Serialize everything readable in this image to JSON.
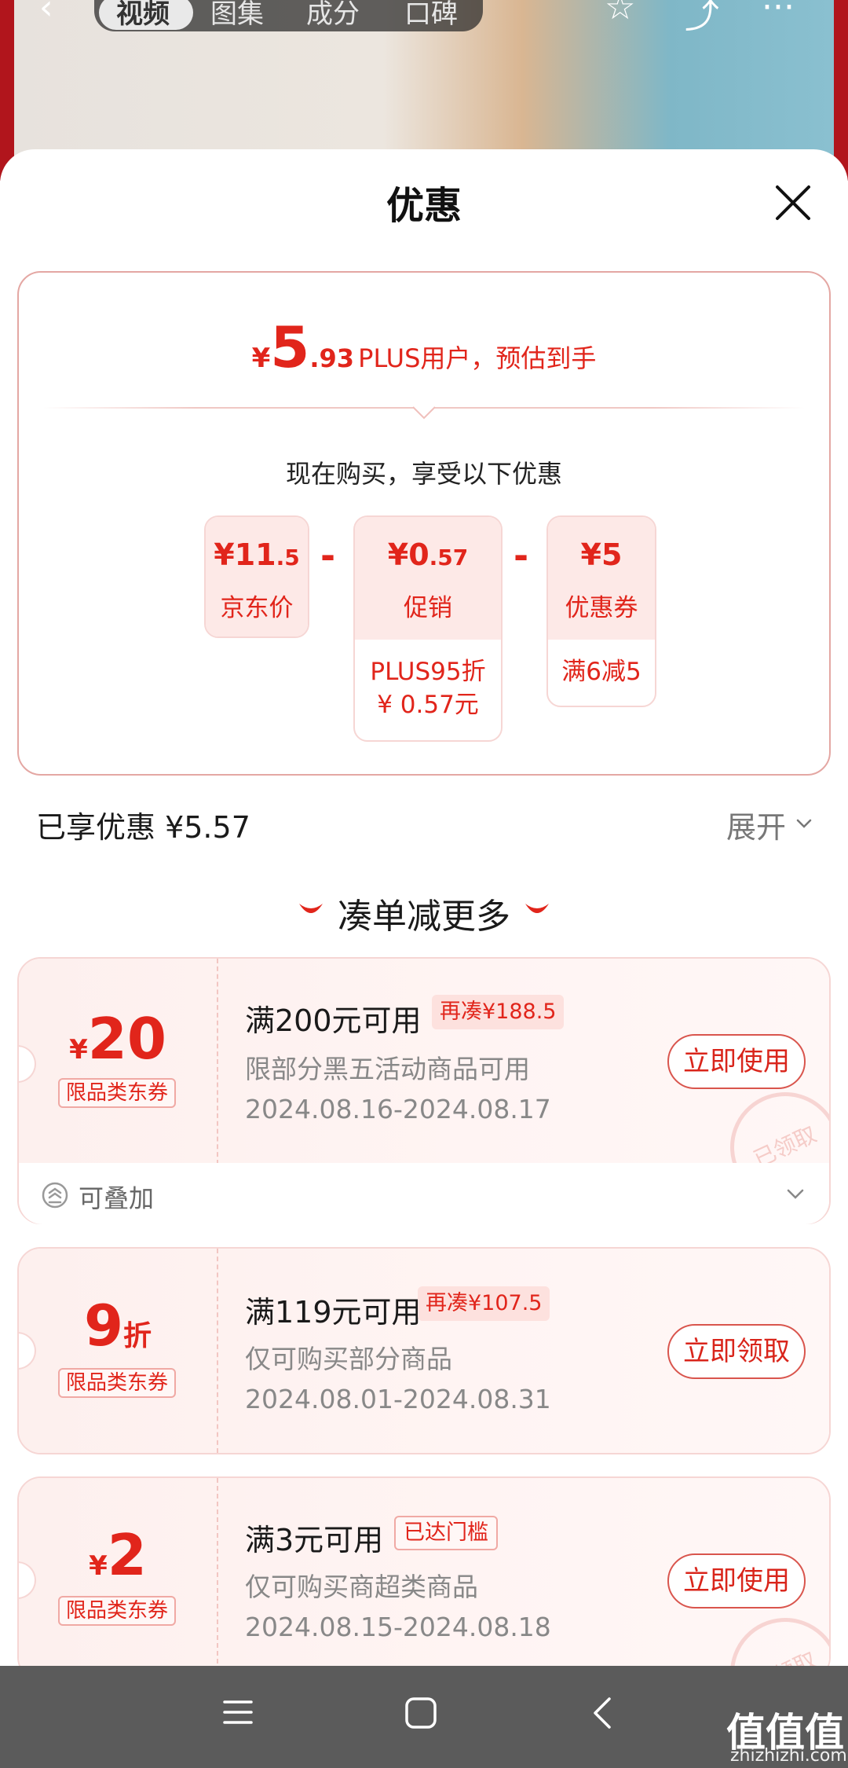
{
  "background": {
    "tabs": [
      "视频",
      "图集",
      "成分",
      "口碑"
    ]
  },
  "sheet": {
    "title": "优惠"
  },
  "summary": {
    "currency": "¥",
    "price_int": "5",
    "price_dec": ".93",
    "price_note": "PLUS用户，预估到手",
    "buy_now_text": "现在购买，享受以下优惠",
    "breakdown": [
      {
        "value_int": "¥11",
        "value_dec": ".5",
        "label": "京东价",
        "desc": ""
      },
      {
        "value_int": "¥0",
        "value_dec": ".57",
        "label": "促销",
        "desc": "PLUS95折\n¥ 0.57元"
      },
      {
        "value_int": "¥5",
        "value_dec": "",
        "label": "优惠券",
        "desc": "满6减5"
      }
    ],
    "minus": "-"
  },
  "enjoyed": {
    "text": "已享优惠 ¥5.57",
    "expand_label": "展开"
  },
  "more_title": "凑单减更多",
  "coupons": [
    {
      "symbol": "¥",
      "amount": "20",
      "unit": "",
      "tag": "限品类东券",
      "title": "满200元可用",
      "badge": "再凑¥188.5",
      "desc": "限部分黑五活动商品可用",
      "date": "2024.08.16-2024.08.17",
      "button": "立即使用",
      "stamp": "已领取",
      "stackable": "可叠加"
    },
    {
      "symbol": "",
      "amount": "9",
      "unit": "折",
      "tag": "限品类东券",
      "title": "满119元可用",
      "badge": "再凑¥107.5",
      "desc": "仅可购买部分商品",
      "date": "2024.08.01-2024.08.31",
      "button": "立即领取"
    },
    {
      "symbol": "¥",
      "amount": "2",
      "unit": "",
      "tag": "限品类东券",
      "title": "满3元可用",
      "badge": "已达门槛",
      "desc": "仅可购买商超类商品",
      "date": "2024.08.15-2024.08.18",
      "button": "立即使用",
      "stamp": "已领取"
    }
  ],
  "watermark": {
    "text": "值值值",
    "sub": "zhizhizhi.com"
  },
  "colors": {
    "accent": "#e1251b",
    "pink_bg": "#fde9e7",
    "navbar": "#5b5b5b"
  }
}
